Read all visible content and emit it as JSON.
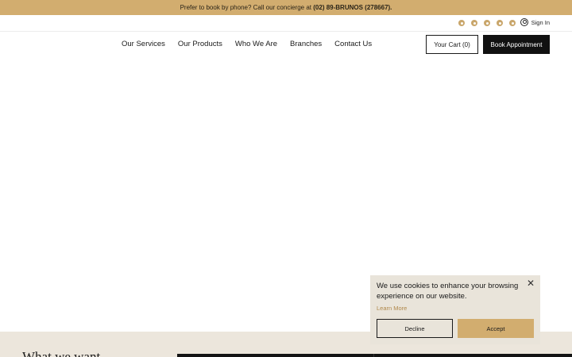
{
  "announcement": {
    "prefix": "Prefer to book by phone? Call our concierge at ",
    "phone": "(02) 89-BRUNOS (278667)."
  },
  "utility": {
    "social_icons": [
      "instagram-icon",
      "facebook-icon",
      "tiktok-icon",
      "whatsapp-icon",
      "pinterest-icon"
    ],
    "signin_label": "Sign In"
  },
  "nav": {
    "items": [
      "Our Services",
      "Our Products",
      "Who We Are",
      "Branches",
      "Contact Us"
    ]
  },
  "header_actions": {
    "cart_label": "Your Cart (0)",
    "book_label": "Book Appointment"
  },
  "section": {
    "heading_partial": "What we want"
  },
  "cookie_banner": {
    "message": "We use cookies to enhance your browsing experience on our website.",
    "learn_more": "Learn More",
    "decline": "Decline",
    "accept": "Accept",
    "close_icon": "close-icon"
  },
  "colors": {
    "accent_gold": "#d2ad6f",
    "dark": "#111111",
    "beige": "#ece6dc",
    "cookie_bg": "#e9e4da"
  }
}
